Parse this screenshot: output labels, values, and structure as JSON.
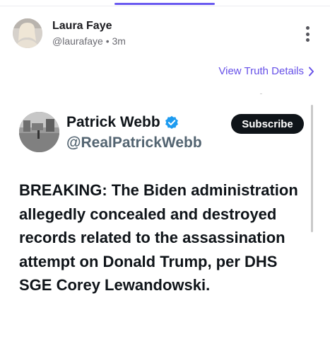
{
  "post": {
    "author_name": "Laura Faye",
    "author_handle": "@laurafaye",
    "separator": "•",
    "time_ago": "3m",
    "view_details_label": "View Truth Details"
  },
  "embed": {
    "name": "Patrick Webb",
    "handle": "@RealPatrickWebb",
    "subscribe_label": "Subscribe",
    "text": "BREAKING: The Biden administration allegedly concealed and destroyed records related to the assassination attempt on Donald Trump, per DHS SGE Corey Lewandowski."
  },
  "colors": {
    "accent": "#6650e8",
    "tab_indicator": "#6a5af0",
    "verified": "#1d9bf0",
    "subscribe_bg": "#0f1419"
  },
  "icons": {
    "more": "vertical-ellipsis-icon",
    "details": "chevron-right-icon",
    "verified": "verified-badge-icon"
  }
}
